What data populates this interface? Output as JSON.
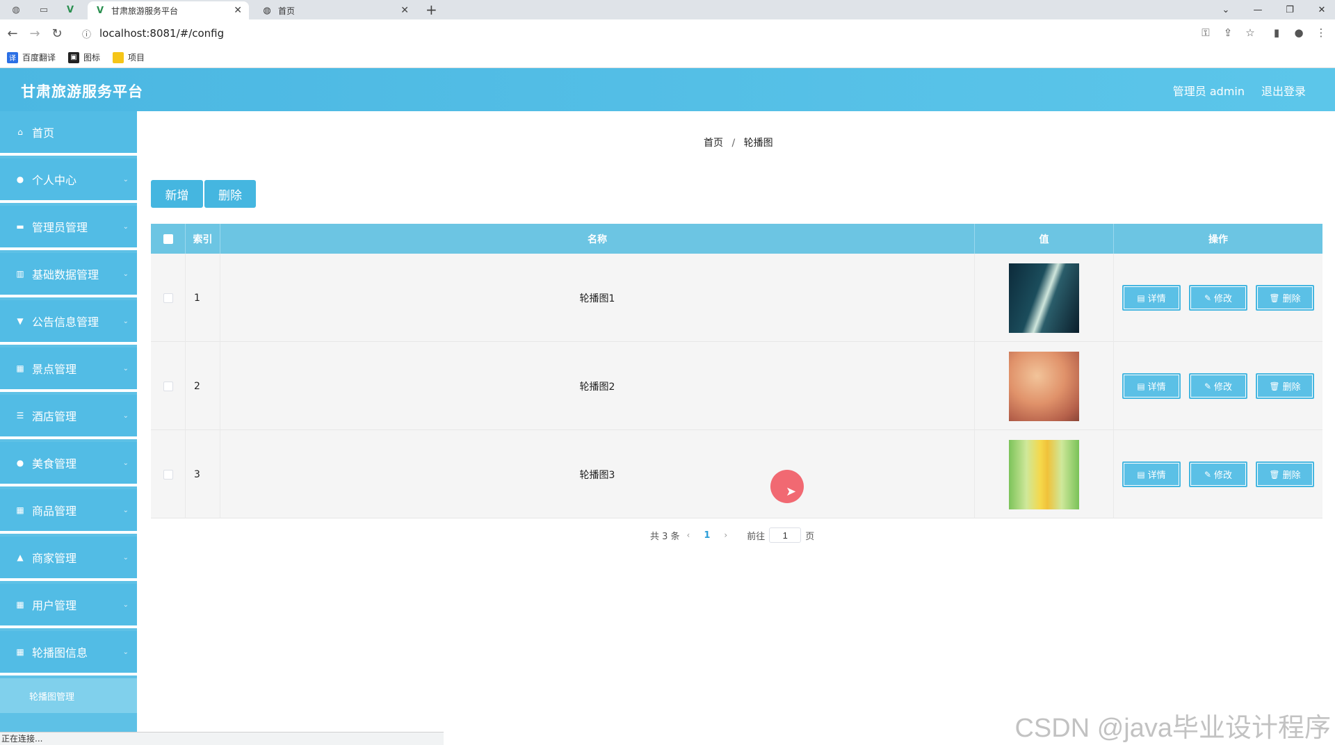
{
  "browser": {
    "tabs": [
      {
        "title": "甘肃旅游服务平台",
        "icon": "vue-logo-icon",
        "active": true
      },
      {
        "title": "首页",
        "icon": "globe-icon",
        "active": false
      }
    ],
    "url": "localhost:8081/#/config",
    "bookmarks": [
      {
        "label": "百度翻译",
        "color": "#2b6fe5"
      },
      {
        "label": "图标",
        "color": "#222222"
      },
      {
        "label": "项目",
        "color": "#f5c518"
      }
    ],
    "status": "正在连接..."
  },
  "header": {
    "title": "甘肃旅游服务平台",
    "admin": "管理员 admin",
    "logout": "退出登录"
  },
  "sidebar": {
    "items": [
      {
        "label": "首页",
        "icon": "home-icon",
        "has_arrow": false
      },
      {
        "label": "个人中心",
        "icon": "user-icon",
        "has_arrow": true
      },
      {
        "label": "管理员管理",
        "icon": "admin-icon",
        "has_arrow": true
      },
      {
        "label": "基础数据管理",
        "icon": "chart-icon",
        "has_arrow": true
      },
      {
        "label": "公告信息管理",
        "icon": "notice-icon",
        "has_arrow": true
      },
      {
        "label": "景点管理",
        "icon": "grid-icon",
        "has_arrow": true
      },
      {
        "label": "酒店管理",
        "icon": "list-icon",
        "has_arrow": true
      },
      {
        "label": "美食管理",
        "icon": "location-icon",
        "has_arrow": true
      },
      {
        "label": "商品管理",
        "icon": "grid-icon",
        "has_arrow": true
      },
      {
        "label": "商家管理",
        "icon": "shop-icon",
        "has_arrow": true
      },
      {
        "label": "用户管理",
        "icon": "grid-icon",
        "has_arrow": true
      },
      {
        "label": "轮播图信息",
        "icon": "grid-icon",
        "has_arrow": true
      }
    ],
    "sub_item": "轮播图管理"
  },
  "main": {
    "breadcrumb": {
      "home": "首页",
      "sep": "/",
      "current": "轮播图"
    },
    "buttons": {
      "add": "新增",
      "delete": "删除"
    },
    "table": {
      "headers": {
        "index": "索引",
        "name": "名称",
        "value": "值",
        "actions": "操作"
      },
      "rows": [
        {
          "index": "1",
          "name": "轮播图1",
          "thumb": "dark-teal-abstract"
        },
        {
          "index": "2",
          "name": "轮播图2",
          "thumb": "orange-blur"
        },
        {
          "index": "3",
          "name": "轮播图3",
          "thumb": "yellow-green-flowers"
        }
      ],
      "actions": {
        "detail": "详情",
        "edit": "修改",
        "remove": "删除"
      }
    },
    "pagination": {
      "total": "共 3 条",
      "current": "1",
      "goto": "前往",
      "page_value": "1",
      "page_suffix": "页"
    }
  },
  "watermark": "CSDN @java毕业设计程序"
}
